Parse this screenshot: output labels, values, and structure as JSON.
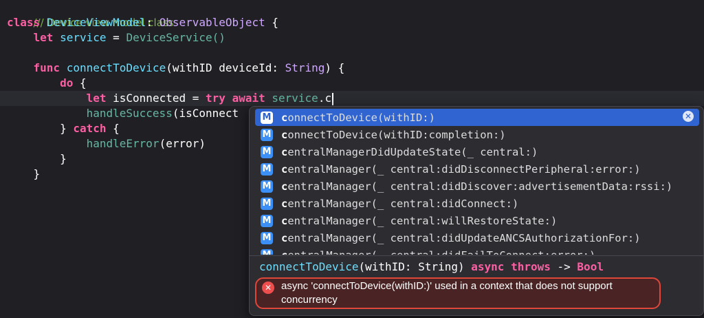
{
  "code": {
    "comment": "/// Device view model class",
    "class_kw": "class",
    "class_name": "DeviceViewModel",
    "colon": ":",
    "protocol": "ObservableObject",
    "open_brace": "{",
    "let_kw": "let",
    "service_var": "service",
    "equals": "=",
    "service_init": "DeviceService()",
    "func_kw": "func",
    "func_name": "connectToDevice",
    "func_params": "(withID deviceId:",
    "param_type": "String",
    "func_close": ") {",
    "do_kw": "do",
    "brace": "{",
    "let2_kw": "let",
    "is_connected": "isConnected =",
    "try_kw": "try",
    "await_kw": "await",
    "service_ref": "service",
    "typed": ".c",
    "handle_success": "handleSuccess",
    "handle_success_rest": "(isConnect",
    "close_brace_catch": "}",
    "catch_kw": "catch",
    "catch_brace": "{",
    "handle_error": "handleError",
    "handle_error_rest": "(error)",
    "close1": "}",
    "close2": "}"
  },
  "completions": [
    {
      "bold": "c",
      "rest": "onnectToDevice(withID:)",
      "badge": "M",
      "selected": true
    },
    {
      "bold": "c",
      "rest": "onnectToDevice(withID:completion:)",
      "badge": "M"
    },
    {
      "bold": "c",
      "rest": "entralManagerDidUpdateState(_ central:)",
      "badge": "M"
    },
    {
      "bold": "c",
      "rest": "entralManager(_ central:didDisconnectPeripheral:error:)",
      "badge": "M"
    },
    {
      "bold": "c",
      "rest": "entralManager(_ central:didDiscover:advertisementData:rssi:)",
      "badge": "M"
    },
    {
      "bold": "c",
      "rest": "entralManager(_ central:didConnect:)",
      "badge": "M"
    },
    {
      "bold": "c",
      "rest": "entralManager(_ central:willRestoreState:)",
      "badge": "M"
    },
    {
      "bold": "c",
      "rest": "entralManager(_ central:didUpdateANCSAuthorizationFor:)",
      "badge": "M"
    },
    {
      "bold": "c",
      "rest": "entralManager(_ central:didFailToConnect:error:)",
      "badge": "M"
    }
  ],
  "signature": {
    "name": "connectToDevice",
    "params": "(withID: String)",
    "async_kw": "async",
    "throws_kw": "throws",
    "arrow": "->",
    "return_type": "Bool"
  },
  "error": {
    "icon": "error-x-icon",
    "message": "async 'connectToDevice(withID:)' used in a context that does not support concurrency"
  },
  "icons": {
    "method_badge": "method-icon",
    "clear": "clear-circle-icon"
  },
  "colors": {
    "background": "#1f1f24",
    "keyword": "#fc5fa3",
    "selection": "#2f64d1",
    "error": "#e0473b"
  }
}
